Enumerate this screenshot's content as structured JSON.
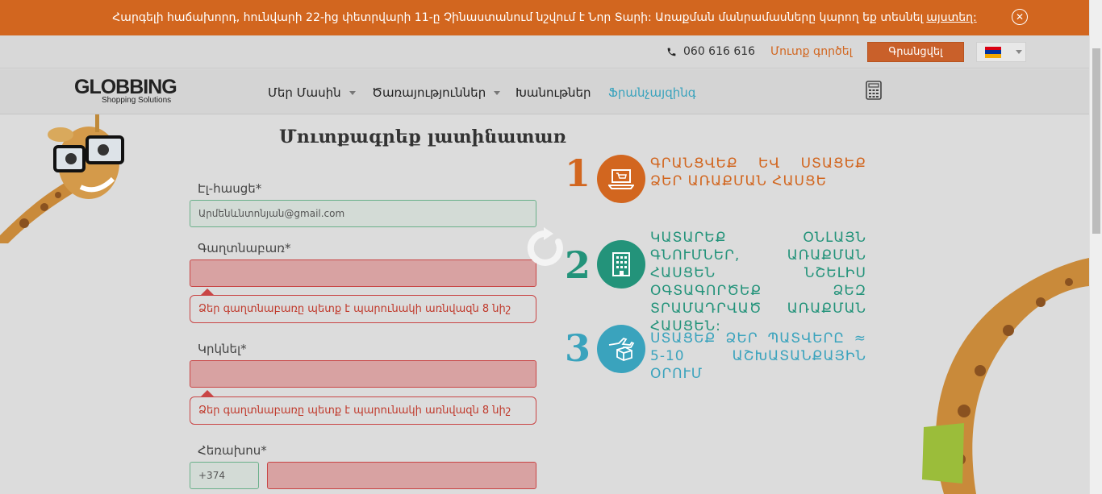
{
  "notice": {
    "text": "Հարգելի հաճախորդ, հունվարի 22-ից փետրվարի 11-ը Չինաստանում նշվում է Նոր Տարի: Առաքման մանրամասները կարող եք տեսնել",
    "link": "այստեղ:"
  },
  "topbar": {
    "phone": "060 616 616",
    "login": "Մուտք գործել",
    "register": "Գրանցվել"
  },
  "brand": {
    "name": "GLOBBING",
    "tagline": "Shopping Solutions"
  },
  "nav": {
    "about": "Մեր Մասին",
    "services": "Ծառայություններ",
    "shops": "Խանութներ",
    "franchise": "Ֆրանչայզինգ"
  },
  "form": {
    "title": "Մուտքագրեք լատինատառ",
    "email_label": "Էլ-հասցե*",
    "email_value": "Արմենևնտոնյան@gmail.com",
    "password_label": "Գաղտնաբառ*",
    "password_error": "Ձեր գաղտնաբառը պետք է պարունակի առնվազն 8 նիշ",
    "repeat_label": "Կրկնել*",
    "repeat_error": "Ձեր գաղտնաբառը պետք է պարունակի առնվազն 8 նիշ",
    "phone_label": "Հեռախոս*",
    "phone_prefix": "+374"
  },
  "steps": [
    {
      "num": "1",
      "text": "ԳՐԱՆՑՎԵՔ ԵՎ ՍՏԱՑԵՔ ՁԵՐ ԱՌԱՔՄԱՆ ՀԱՍՑԵ",
      "icon": "laptop-cart-icon",
      "color": "#d2661f"
    },
    {
      "num": "2",
      "text": "ԿԱՏԱՐԵՔ ՕՆԼԱՅՆ ԳՆՈՒՄՆԵՐ, ԱՌԱՔՄԱՆ ՀԱՍՑԵՆ ՆՇԵԼԻՍ ՕԳՏԱԳՈՐԾԵՔ ՁԵԶ ՏՐԱՄԱԴՐՎԱԾ ԱՌԱՔՄԱՆ ՀԱՍՑԵՆ:",
      "icon": "building-icon",
      "color": "#23937a"
    },
    {
      "num": "3",
      "text": "ՍՏԱՑԵՔ ՁԵՐ ՊԱՏՎԵՐԸ ≈ 5-10 ԱՇԽԱՏԱՆՔԱՅԻՆ ՕՐՈՒՄ",
      "icon": "plane-box-icon",
      "color": "#3aa3bd"
    }
  ],
  "colors": {
    "orange": "#d2661f",
    "green": "#23937a",
    "blue": "#3aa3bd",
    "error": "#c94545"
  }
}
